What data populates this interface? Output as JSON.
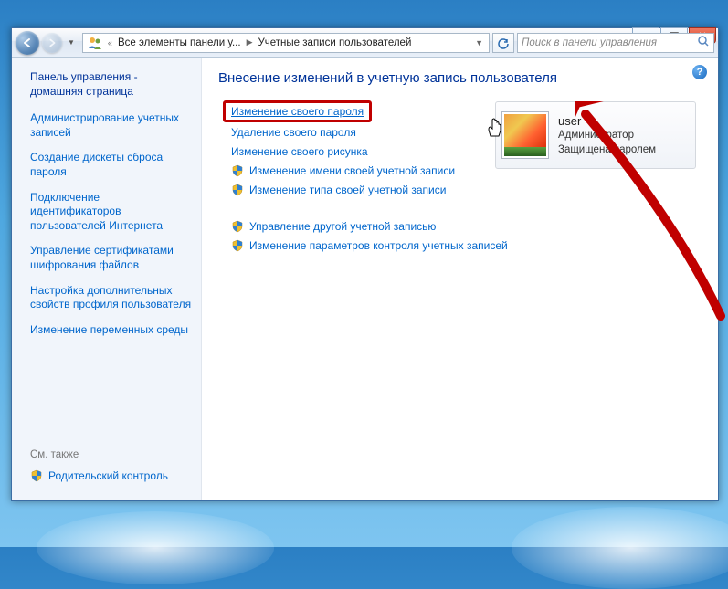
{
  "breadcrumb": {
    "seg1": "Все элементы панели у...",
    "seg2": "Учетные записи пользователей"
  },
  "search": {
    "placeholder": "Поиск в панели управления"
  },
  "sidebar": {
    "home": "Панель управления - домашняя страница",
    "links": [
      "Администрирование учетных записей",
      "Создание дискеты сброса пароля",
      "Подключение идентификаторов пользователей Интернета",
      "Управление сертификатами шифрования файлов",
      "Настройка дополнительных свойств профиля пользователя",
      "Изменение переменных среды"
    ],
    "also": "См. также",
    "parental": "Родительский контроль"
  },
  "main": {
    "title": "Внесение изменений в учетную запись пользователя",
    "tasks": [
      "Изменение своего пароля",
      "Удаление своего пароля",
      "Изменение своего рисунка",
      "Изменение имени своей учетной записи",
      "Изменение типа своей учетной записи"
    ],
    "tasks2": [
      "Управление другой учетной записью",
      "Изменение параметров контроля учетных записей"
    ]
  },
  "user": {
    "name": "user",
    "role": "Администратор",
    "status": "Защищена паролем"
  }
}
